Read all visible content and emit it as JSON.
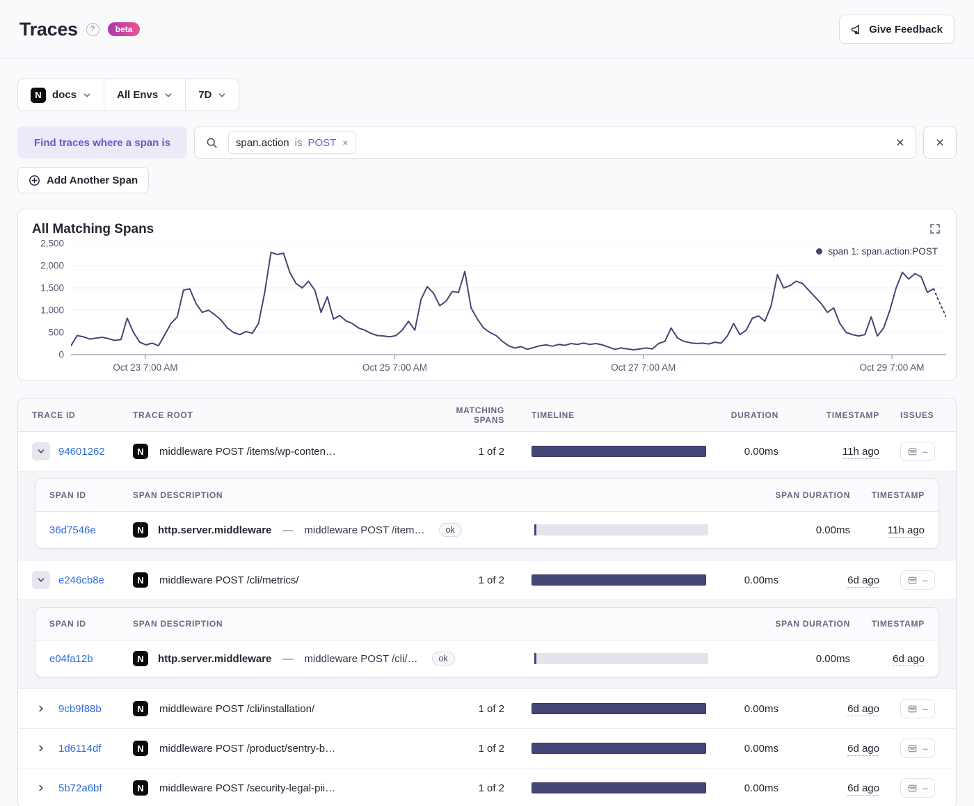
{
  "header": {
    "title": "Traces",
    "help_glyph": "?",
    "beta_badge": "beta",
    "feedback_button": "Give Feedback"
  },
  "filter_bar": {
    "project": "docs",
    "project_logo": "N",
    "environment": "All Envs",
    "date_range": "7D"
  },
  "span_filter": {
    "label": "Find traces where a span is",
    "chip": {
      "key": "span.action",
      "op": "is",
      "value": "POST",
      "remove_glyph": "×"
    },
    "clear_glyph": "×",
    "remove_filter_glyph": "×",
    "add_span_button": "Add Another Span"
  },
  "chart": {
    "title": "All Matching Spans",
    "legend_label": "span 1: span.action:POST"
  },
  "chart_data": {
    "type": "line",
    "title": "All Matching Spans",
    "series": [
      {
        "name": "span 1: span.action:POST",
        "color": "#444674"
      }
    ],
    "ylim": [
      0,
      2500
    ],
    "yticks": [
      0,
      500,
      1000,
      1500,
      2000,
      2500
    ],
    "ytick_labels": [
      "2,500",
      "2,000",
      "1,500",
      "1,000",
      "500",
      "0"
    ],
    "xticks": [
      {
        "label": "Oct 23 7:00 AM",
        "pos": 0.085
      },
      {
        "label": "Oct 25 7:00 AM",
        "pos": 0.37
      },
      {
        "label": "Oct 27 7:00 AM",
        "pos": 0.654
      },
      {
        "label": "Oct 29 7:00 AM",
        "pos": 0.938
      }
    ],
    "grid": true,
    "legend_position": "top-right",
    "dashed_from": 138,
    "values": [
      200,
      430,
      400,
      350,
      370,
      390,
      360,
      320,
      340,
      820,
      500,
      280,
      220,
      260,
      200,
      450,
      700,
      850,
      1450,
      1480,
      1150,
      950,
      1000,
      900,
      780,
      600,
      500,
      450,
      520,
      480,
      700,
      1400,
      2300,
      2250,
      2280,
      1850,
      1600,
      1500,
      1650,
      1450,
      950,
      1300,
      800,
      880,
      760,
      700,
      600,
      550,
      480,
      430,
      420,
      400,
      430,
      550,
      750,
      550,
      1240,
      1530,
      1380,
      1100,
      1200,
      1420,
      1400,
      1870,
      1050,
      800,
      600,
      500,
      430,
      300,
      200,
      150,
      180,
      120,
      160,
      200,
      220,
      190,
      230,
      210,
      250,
      230,
      260,
      230,
      250,
      220,
      170,
      120,
      150,
      130,
      110,
      130,
      150,
      130,
      250,
      300,
      600,
      380,
      300,
      270,
      250,
      260,
      240,
      280,
      260,
      420,
      700,
      450,
      550,
      820,
      870,
      750,
      1100,
      1800,
      1500,
      1550,
      1650,
      1600,
      1450,
      1300,
      1150,
      950,
      1050,
      700,
      500,
      450,
      420,
      450,
      850,
      420,
      600,
      1000,
      1500,
      1850,
      1700,
      1820,
      1750,
      1400,
      1480,
      1150,
      850
    ]
  },
  "table": {
    "columns": [
      "TRACE ID",
      "TRACE ROOT",
      "MATCHING SPANS",
      "TIMELINE",
      "DURATION",
      "TIMESTAMP",
      "ISSUES"
    ],
    "span_columns": [
      "SPAN ID",
      "SPAN DESCRIPTION",
      "SPAN DURATION",
      "TIMESTAMP"
    ],
    "issues_empty": "–",
    "rows": [
      {
        "id": "94601262",
        "root": "middleware POST /items/wp-conten…",
        "matching": "1 of 2",
        "duration": "0.00ms",
        "timestamp": "11h ago",
        "expanded": true,
        "spans": [
          {
            "id": "36d7546e",
            "op": "http.server.middleware",
            "separator": "—",
            "description": "middleware POST /item…",
            "status": "ok",
            "duration": "0.00ms",
            "timestamp": "11h ago"
          }
        ]
      },
      {
        "id": "e246cb8e",
        "root": "middleware POST /cli/metrics/",
        "matching": "1 of 2",
        "duration": "0.00ms",
        "timestamp": "6d ago",
        "expanded": true,
        "spans": [
          {
            "id": "e04fa12b",
            "op": "http.server.middleware",
            "separator": "—",
            "description": "middleware POST /cli/…",
            "status": "ok",
            "duration": "0.00ms",
            "timestamp": "6d ago"
          }
        ]
      },
      {
        "id": "9cb9f88b",
        "root": "middleware POST /cli/installation/",
        "matching": "1 of 2",
        "duration": "0.00ms",
        "timestamp": "6d ago",
        "expanded": false
      },
      {
        "id": "1d6114df",
        "root": "middleware POST /product/sentry-b…",
        "matching": "1 of 2",
        "duration": "0.00ms",
        "timestamp": "6d ago",
        "expanded": false
      },
      {
        "id": "5b72a6bf",
        "root": "middleware POST /security-legal-pii…",
        "matching": "1 of 2",
        "duration": "0.00ms",
        "timestamp": "6d ago",
        "expanded": false
      }
    ]
  },
  "colors": {
    "accent_purple": "#6559C5",
    "link_blue": "#2F6BD9",
    "chart_navy": "#444674",
    "timeline_bar": "#454577",
    "text_dark": "#2B2233",
    "text_muted": "#6F6287",
    "beta_gradient_start": "#A737B4",
    "beta_gradient_end": "#F0538C",
    "page_bg": "#FAF9FB"
  }
}
